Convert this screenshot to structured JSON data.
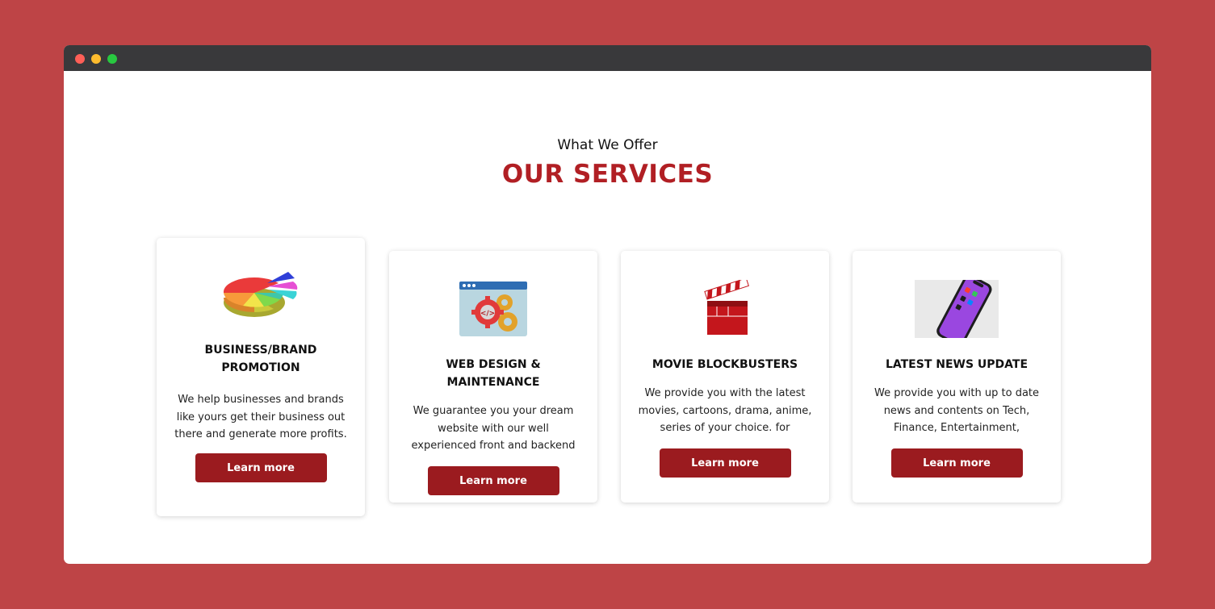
{
  "header": {
    "kicker": "What We Offer",
    "title": "OUR SERVICES"
  },
  "colors": {
    "background": "#be4446",
    "accent": "#b11f24",
    "button": "#9b1b1f",
    "titlebar": "#39393b"
  },
  "cards": [
    {
      "icon": "pie-chart-icon",
      "title": "BUSINESS/BRAND PROMOTION",
      "description": "We help businesses and brands like yours get their business out there and generate more profits.",
      "button": "Learn more"
    },
    {
      "icon": "web-design-gears-icon",
      "title": "WEB DESIGN & MAINTENANCE",
      "description": "We guarantee you your dream website with our well experienced front and backend developers...",
      "button": "Learn more"
    },
    {
      "icon": "clapperboard-icon",
      "title": "MOVIE BLOCKBUSTERS",
      "description": "We provide you with the latest movies, cartoons, drama, anime, series of your choice. for movies!!",
      "button": "Learn more"
    },
    {
      "icon": "smartphone-icon",
      "title": "LATEST NEWS UPDATE",
      "description": "We provide you with up to date news and contents on Tech, Finance, Entertainment,",
      "button": "Learn more"
    }
  ]
}
